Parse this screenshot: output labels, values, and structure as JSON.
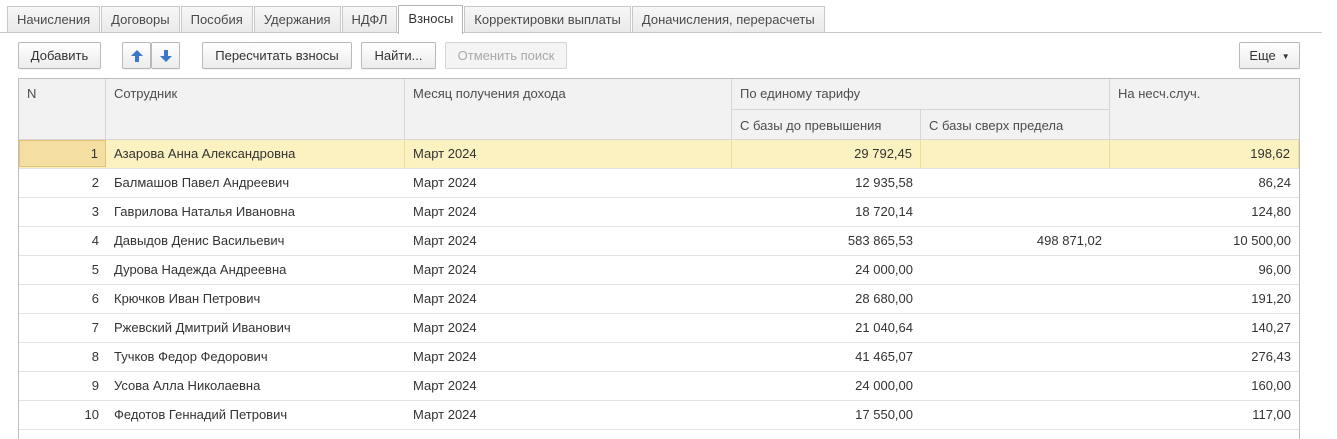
{
  "tabs": [
    {
      "label": "Начисления"
    },
    {
      "label": "Договоры"
    },
    {
      "label": "Пособия"
    },
    {
      "label": "Удержания"
    },
    {
      "label": "НДФЛ"
    },
    {
      "label": "Взносы",
      "active": true
    },
    {
      "label": "Корректировки выплаты"
    },
    {
      "label": "Доначисления, перерасчеты"
    }
  ],
  "toolbar": {
    "add_label": "Добавить",
    "move_up_icon": "arrow-up-icon",
    "move_down_icon": "arrow-down-icon",
    "recalc_label": "Пересчитать взносы",
    "find_label": "Найти...",
    "cancel_search_label": "Отменить поиск",
    "more_label": "Еще",
    "accent_color": "#3a78c9"
  },
  "table": {
    "columns": {
      "n": "N",
      "employee": "Сотрудник",
      "month": "Месяц получения дохода",
      "unified_group": "По единому тарифу",
      "base_below": "С базы до превышения",
      "base_above": "С базы сверх предела",
      "accident": "На несч.случ."
    },
    "rows": [
      {
        "n": "1",
        "employee": "Азарова Анна Александровна",
        "month": "Март 2024",
        "base_below": "29 792,45",
        "base_above": "",
        "accident": "198,62"
      },
      {
        "n": "2",
        "employee": "Балмашов Павел Андреевич",
        "month": "Март 2024",
        "base_below": "12 935,58",
        "base_above": "",
        "accident": "86,24"
      },
      {
        "n": "3",
        "employee": "Гаврилова Наталья Ивановна",
        "month": "Март 2024",
        "base_below": "18 720,14",
        "base_above": "",
        "accident": "124,80"
      },
      {
        "n": "4",
        "employee": "Давыдов Денис Васильевич",
        "month": "Март 2024",
        "base_below": "583 865,53",
        "base_above": "498 871,02",
        "accident": "10 500,00"
      },
      {
        "n": "5",
        "employee": "Дурова Надежда Андреевна",
        "month": "Март 2024",
        "base_below": "24 000,00",
        "base_above": "",
        "accident": "96,00"
      },
      {
        "n": "6",
        "employee": "Крючков Иван Петрович",
        "month": "Март 2024",
        "base_below": "28 680,00",
        "base_above": "",
        "accident": "191,20"
      },
      {
        "n": "7",
        "employee": "Ржевский Дмитрий Иванович",
        "month": "Март 2024",
        "base_below": "21 040,64",
        "base_above": "",
        "accident": "140,27"
      },
      {
        "n": "8",
        "employee": "Тучков Федор Федорович",
        "month": "Март 2024",
        "base_below": "41 465,07",
        "base_above": "",
        "accident": "276,43"
      },
      {
        "n": "9",
        "employee": "Усова Алла Николаевна",
        "month": "Март 2024",
        "base_below": "24 000,00",
        "base_above": "",
        "accident": "160,00"
      },
      {
        "n": "10",
        "employee": "Федотов Геннадий Петрович",
        "month": "Март 2024",
        "base_below": "17 550,00",
        "base_above": "",
        "accident": "117,00"
      }
    ],
    "selected_row_color": "#fbf1c1"
  }
}
